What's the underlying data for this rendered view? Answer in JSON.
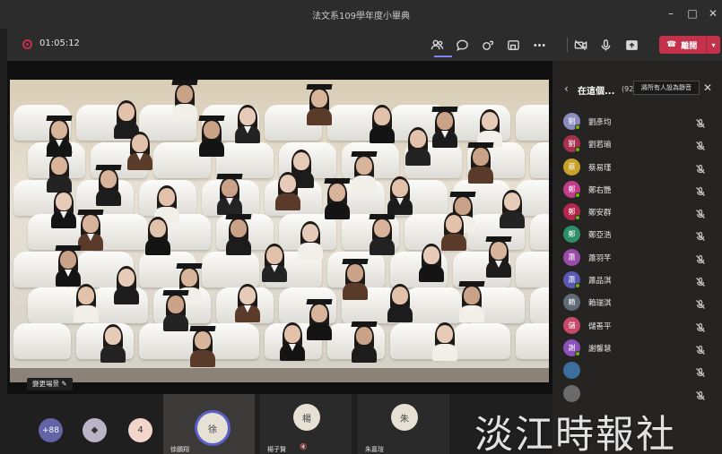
{
  "window": {
    "title": "法文系109學年度小畢典",
    "controls": [
      "minimize",
      "maximize",
      "close"
    ]
  },
  "toolbar": {
    "timer": "01:05:12",
    "icons": [
      "people-icon",
      "chat-icon",
      "reactions-icon",
      "share-tray-icon",
      "more-icon",
      "camera-off-icon",
      "mic-icon",
      "share-icon"
    ],
    "leave_label": "離開"
  },
  "stage": {
    "change_background_label": "變更場景"
  },
  "panel": {
    "title": "在這個...",
    "count": "(92)",
    "mute_all_label": "將所有人設為靜音",
    "participants": [
      {
        "name": "劉彥均",
        "initial": "劉",
        "color": "#8b8bbf",
        "dot": true
      },
      {
        "name": "劉若瑜",
        "initial": "劉",
        "color": "#a8324e",
        "dot": true
      },
      {
        "name": "蔡易瑾",
        "initial": "蔡",
        "color": "#c7a128",
        "dot": false
      },
      {
        "name": "鄭右艷",
        "initial": "鄭",
        "color": "#c13d8a",
        "dot": true
      },
      {
        "name": "鄭安群",
        "initial": "鄭",
        "color": "#b4284f",
        "dot": true
      },
      {
        "name": "鄭亞浩",
        "initial": "鄭",
        "color": "#2f8f6c",
        "dot": false
      },
      {
        "name": "蕭羽芊",
        "initial": "蕭",
        "color": "#9a4aa8",
        "dot": false
      },
      {
        "name": "蕭品淇",
        "initial": "蕭",
        "color": "#5a5ab5",
        "dot": true
      },
      {
        "name": "賴瑞淇",
        "initial": "賴",
        "color": "#5f6b75",
        "dot": false
      },
      {
        "name": "儲善平",
        "initial": "儲",
        "color": "#c7486a",
        "dot": false
      },
      {
        "name": "謝馨慧",
        "initial": "謝",
        "color": "#8a52b8",
        "dot": true
      },
      {
        "name": "",
        "initial": "",
        "color": "#3c6e9e",
        "dot": false
      },
      {
        "name": "",
        "initial": "",
        "color": "#6b6b6b",
        "dot": false
      }
    ]
  },
  "strip": {
    "overflow_count": "+88",
    "avatar_count": "4",
    "tiles": [
      {
        "initial": "徐",
        "name": "徐鵬翔"
      },
      {
        "initial": "楊",
        "name": "楊子賢"
      },
      {
        "initial": "朱",
        "name": "朱嘉瑄"
      }
    ]
  },
  "watermark": "淡江時報社"
}
